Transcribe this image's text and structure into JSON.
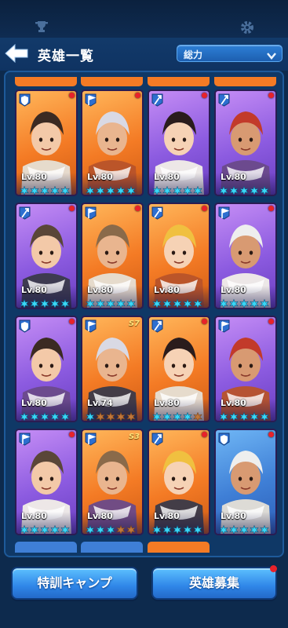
{
  "header": {
    "title": "英雄一覧",
    "sort_label": "総力"
  },
  "buttons": {
    "training": "特訓キャンプ",
    "recruit": "英雄募集"
  },
  "colors": {
    "orange_card": "#f47b25",
    "purple_card": "#8c5be0",
    "blue_card": "#3f7fd6",
    "star_filled": "#3ad7f5",
    "star_empty": "#c0773a",
    "notify": "#e8222a"
  },
  "heroes": [
    {
      "level": "Lv.80",
      "rarity": "orange",
      "class": "shield",
      "stars": 5,
      "skill": ""
    },
    {
      "level": "Lv.80",
      "rarity": "orange",
      "class": "flag",
      "stars": 5,
      "skill": ""
    },
    {
      "level": "Lv.80",
      "rarity": "purple",
      "class": "axe",
      "stars": 5,
      "skill": ""
    },
    {
      "level": "Lv.80",
      "rarity": "purple",
      "class": "axe",
      "stars": 5,
      "skill": ""
    },
    {
      "level": "Lv.80",
      "rarity": "purple",
      "class": "axe",
      "stars": 5,
      "skill": ""
    },
    {
      "level": "Lv.80",
      "rarity": "orange",
      "class": "flag",
      "stars": 5,
      "skill": ""
    },
    {
      "level": "Lv.80",
      "rarity": "orange",
      "class": "axe",
      "stars": 5,
      "skill": ""
    },
    {
      "level": "Lv.80",
      "rarity": "purple",
      "class": "flag",
      "stars": 5,
      "skill": ""
    },
    {
      "level": "Lv.80",
      "rarity": "purple",
      "class": "shield",
      "stars": 5,
      "skill": ""
    },
    {
      "level": "Lv.74",
      "rarity": "orange",
      "class": "flag",
      "stars": 1,
      "skill": "S7"
    },
    {
      "level": "Lv.80",
      "rarity": "orange",
      "class": "axe",
      "stars": 4,
      "skill": ""
    },
    {
      "level": "Lv.80",
      "rarity": "purple",
      "class": "flag",
      "stars": 5,
      "skill": ""
    },
    {
      "level": "Lv.80",
      "rarity": "purple",
      "class": "flag",
      "stars": 5,
      "skill": ""
    },
    {
      "level": "Lv.80",
      "rarity": "orange",
      "class": "flag",
      "stars": 3,
      "skill": "S3"
    },
    {
      "level": "Lv.80",
      "rarity": "orange",
      "class": "axe",
      "stars": 5,
      "skill": ""
    },
    {
      "level": "Lv.80",
      "rarity": "blue",
      "class": "shield",
      "stars": 5,
      "skill": ""
    }
  ]
}
